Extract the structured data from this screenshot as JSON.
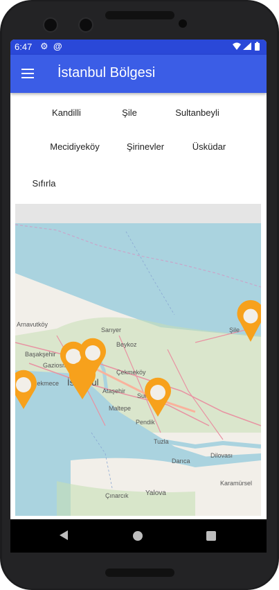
{
  "status": {
    "time": "6:47"
  },
  "app": {
    "title": "İstanbul Bölgesi"
  },
  "buttons": [
    "Kandilli",
    "Şile",
    "Sultanbeyli",
    "Mecidiyeköy",
    "Şirinevler",
    "Üsküdar",
    "Sıfırla"
  ],
  "map": {
    "places": [
      "Arnavutköy",
      "Şile",
      "Sarıyer",
      "Beykoz",
      "Başakşehir",
      "Gaziosmanpaşa",
      "Küçükçekmece",
      "İstanbul",
      "Ataşehir",
      "Çekmeköy",
      "Sultanbeyli",
      "Maltepe",
      "Pendik",
      "Tuzla",
      "Darıca",
      "Dilovası",
      "Karamürsel",
      "Çınarcık",
      "Yalova"
    ],
    "marker_color": "#f7a11c",
    "land_color": "#f2efe9",
    "sea_color": "#aad3df",
    "forest_color": "#c6dfb5"
  },
  "colors": {
    "status_bar": "#2a48d8",
    "app_bar": "#3b5de6"
  }
}
